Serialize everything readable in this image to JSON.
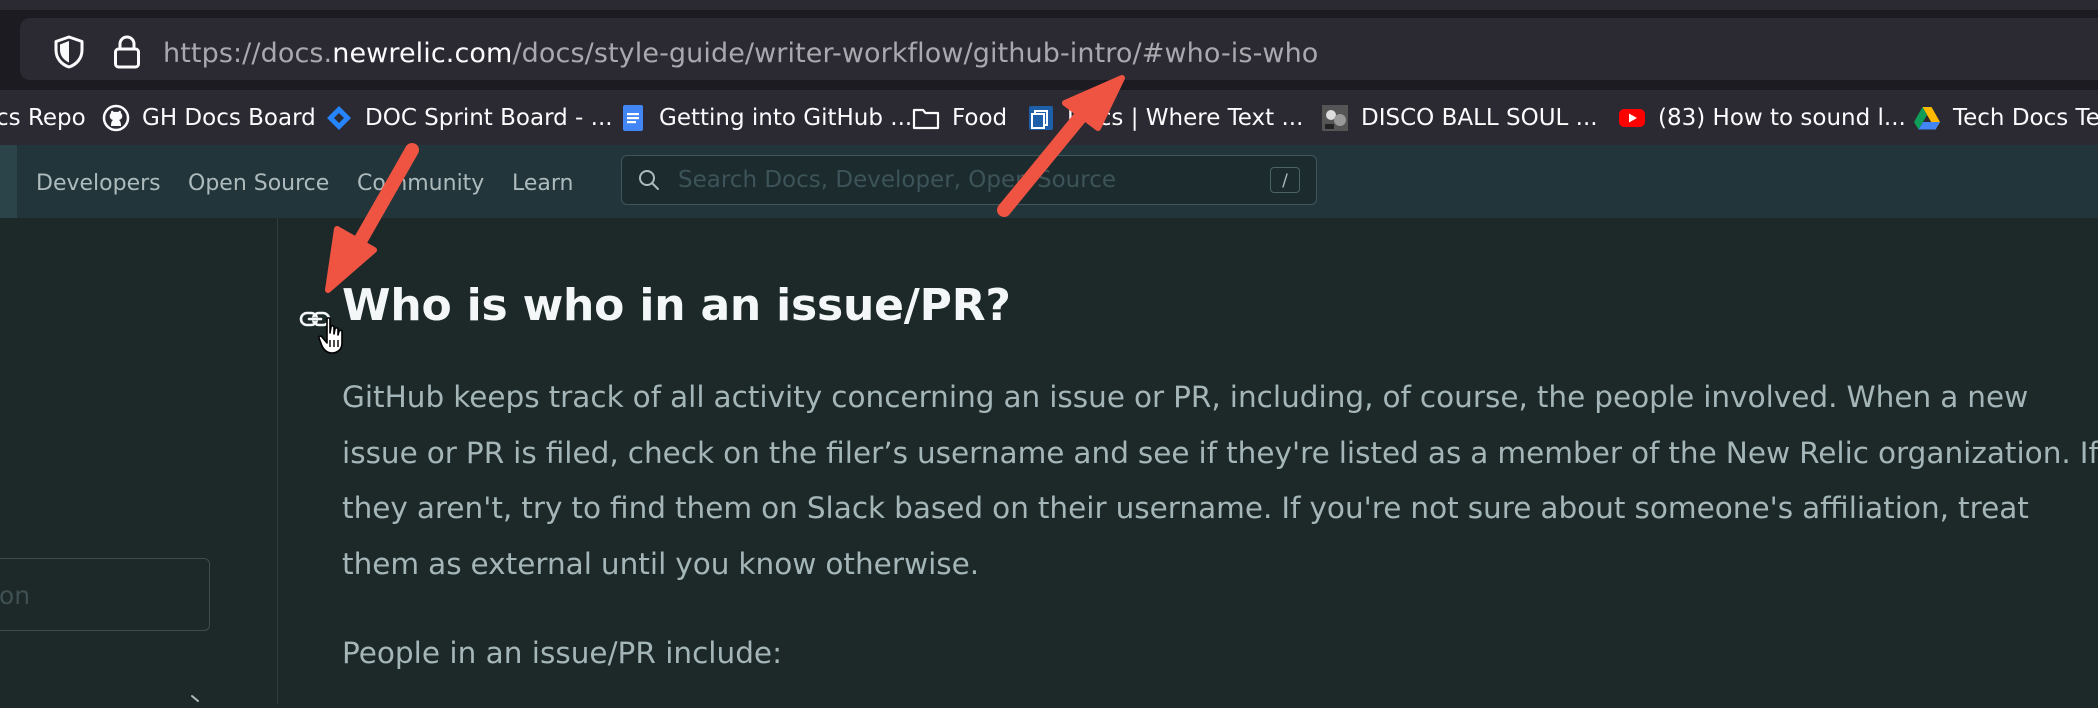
{
  "browser": {
    "url_prefix": "https://docs.",
    "url_host": "newrelic.com",
    "url_path": "/docs/style-guide/writer-workflow/github-intro/#who-is-who"
  },
  "bookmarks": [
    {
      "label": "cs Repo",
      "icon": "none"
    },
    {
      "label": "GH Docs Board",
      "icon": "github-icon"
    },
    {
      "label": "DOC Sprint Board - ...",
      "icon": "jira-icon"
    },
    {
      "label": "Getting into GitHub ...",
      "icon": "google-docs-icon"
    },
    {
      "label": "Food",
      "icon": "folder-icon"
    },
    {
      "label": "Docs | Where Text ...",
      "icon": "docs-site-icon"
    },
    {
      "label": "DISCO BALL SOUL ...",
      "icon": "thumbnail-icon"
    },
    {
      "label": "(83) How to sound l...",
      "icon": "youtube-icon"
    },
    {
      "label": "Tech Docs Tea",
      "icon": "google-drive-icon"
    }
  ],
  "site_nav": {
    "links": [
      "Developers",
      "Open Source",
      "Community",
      "Learn"
    ],
    "search_placeholder": "Search Docs, Developer, Open Source",
    "search_shortcut": "/"
  },
  "sidebar": {
    "partial_field_text": "on"
  },
  "content": {
    "heading": "Who is who in an issue/PR?",
    "paragraph_lines": [
      "GitHub keeps track of all activity concerning an issue or PR, including, of course, the people involved. When a new",
      "issue or PR is filed, check on the filer’s username and see if they're listed as a member of the New Relic organization. If",
      "they aren't, try to find them on Slack based on their username. If you're not sure about someone's affiliation, treat",
      "them as external until you know otherwise."
    ],
    "people_intro": "People in an issue/PR include:"
  },
  "colors": {
    "annotation_arrow": "#ef5443",
    "page_bg": "#1d2829",
    "header_bg": "#22353a"
  }
}
